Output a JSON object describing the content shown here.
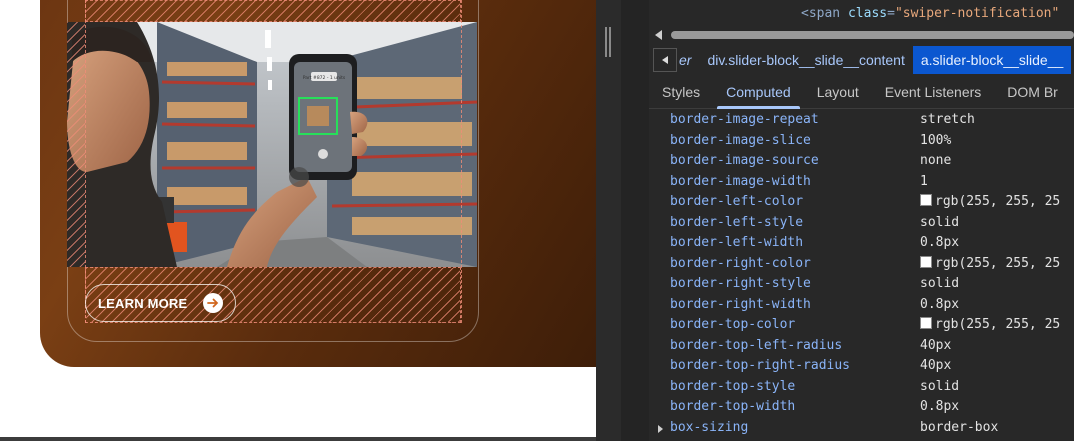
{
  "page": {
    "cta_label": "LEARN MORE",
    "arrow_icon": "arrow-right-icon",
    "photo_alt_icon": "warehouse-phone-scan-image",
    "phone_screen_text": "Part #872 - 1 units",
    "colors": {
      "hero_brown": "#6b3512",
      "hatch": "#f08c78"
    }
  },
  "devtools": {
    "elements_line": {
      "tag_open": "<span",
      "attr_name": "class",
      "attr_value": "\"swiper-notification\""
    },
    "breadcrumbs": {
      "first": "er",
      "second": "div.slider-block__slide__content",
      "active": "a.slider-block__slide__"
    },
    "tabs": [
      "Styles",
      "Computed",
      "Layout",
      "Event Listeners",
      "DOM Br"
    ],
    "active_tab": "Computed",
    "properties": [
      {
        "name": "border-image-repeat",
        "value": "stretch"
      },
      {
        "name": "border-image-slice",
        "value": "100%"
      },
      {
        "name": "border-image-source",
        "value": "none"
      },
      {
        "name": "border-image-width",
        "value": "1"
      },
      {
        "name": "border-left-color",
        "value": "rgb(255, 255, 25",
        "swatch": true
      },
      {
        "name": "border-left-style",
        "value": "solid"
      },
      {
        "name": "border-left-width",
        "value": "0.8px"
      },
      {
        "name": "border-right-color",
        "value": "rgb(255, 255, 25",
        "swatch": true
      },
      {
        "name": "border-right-style",
        "value": "solid"
      },
      {
        "name": "border-right-width",
        "value": "0.8px"
      },
      {
        "name": "border-top-color",
        "value": "rgb(255, 255, 25",
        "swatch": true
      },
      {
        "name": "border-top-left-radius",
        "value": "40px"
      },
      {
        "name": "border-top-right-radius",
        "value": "40px"
      },
      {
        "name": "border-top-style",
        "value": "solid"
      },
      {
        "name": "border-top-width",
        "value": "0.8px"
      },
      {
        "name": "box-sizing",
        "value": "border-box",
        "expandable": true
      }
    ]
  }
}
